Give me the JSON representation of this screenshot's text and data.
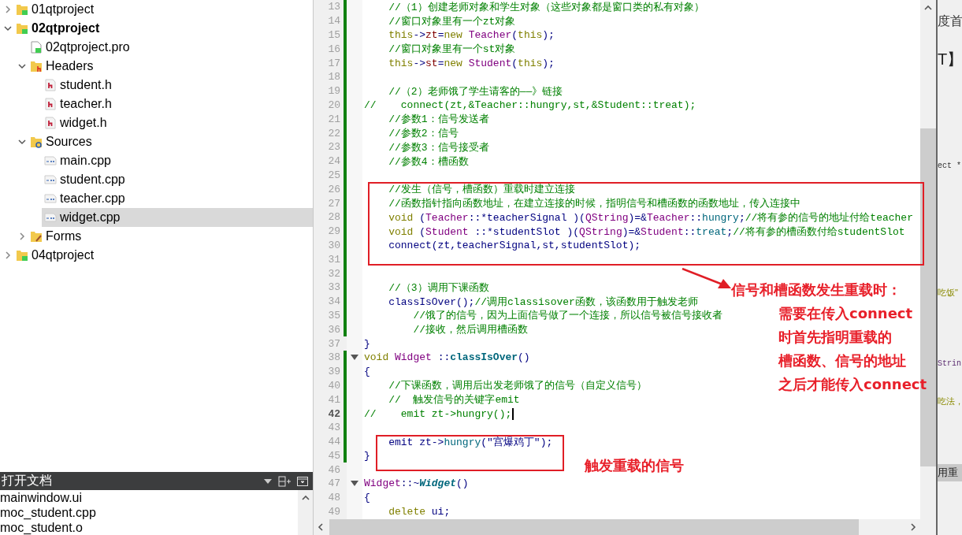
{
  "tree": {
    "items": [
      {
        "label": "01qtproject",
        "kind": "project",
        "expanded": false,
        "active": false,
        "selected": false
      },
      {
        "label": "02qtproject",
        "kind": "project",
        "expanded": true,
        "active": true,
        "selected": false,
        "children": [
          {
            "label": "02qtproject.pro",
            "kind": "pro",
            "selected": false
          },
          {
            "label": "Headers",
            "kind": "headers",
            "expanded": true,
            "selected": false,
            "children": [
              {
                "label": "student.h",
                "kind": "header",
                "selected": false
              },
              {
                "label": "teacher.h",
                "kind": "header",
                "selected": false
              },
              {
                "label": "widget.h",
                "kind": "header",
                "selected": false
              }
            ]
          },
          {
            "label": "Sources",
            "kind": "sources",
            "expanded": true,
            "selected": false,
            "children": [
              {
                "label": "main.cpp",
                "kind": "source",
                "selected": false
              },
              {
                "label": "student.cpp",
                "kind": "source",
                "selected": false
              },
              {
                "label": "teacher.cpp",
                "kind": "source",
                "selected": false
              },
              {
                "label": "widget.cpp",
                "kind": "source",
                "selected": true
              }
            ]
          },
          {
            "label": "Forms",
            "kind": "forms",
            "expanded": false,
            "selected": false
          }
        ]
      },
      {
        "label": "04qtproject",
        "kind": "project",
        "expanded": false,
        "active": false,
        "selected": false
      }
    ]
  },
  "open_documents": {
    "title": "打开文档",
    "files": [
      "mainwindow.ui",
      "moc_student.cpp",
      "moc_student.o"
    ]
  },
  "editor": {
    "lines": [
      {
        "number": "13",
        "modified": true,
        "foldable": false,
        "current": false,
        "segments": [
          {
            "kind": "comment",
            "text": "    //（1）创建老师对象和学生对象（这些对象都是窗口类的私有对象）"
          }
        ]
      },
      {
        "number": "14",
        "modified": true,
        "foldable": false,
        "current": false,
        "segments": [
          {
            "kind": "comment",
            "text": "    //窗口对象里有一个zt对象"
          }
        ]
      },
      {
        "number": "15",
        "modified": true,
        "foldable": false,
        "current": false,
        "segments": [
          {
            "kind": "keyword",
            "text": "    this"
          },
          {
            "kind": "plain",
            "text": "->"
          },
          {
            "kind": "member",
            "text": "zt"
          },
          {
            "kind": "plain",
            "text": "="
          },
          {
            "kind": "keyword",
            "text": "new"
          },
          {
            "kind": "type",
            "text": " Teacher"
          },
          {
            "kind": "plain",
            "text": "("
          },
          {
            "kind": "keyword",
            "text": "this"
          },
          {
            "kind": "plain",
            "text": ");"
          }
        ]
      },
      {
        "number": "16",
        "modified": true,
        "foldable": false,
        "current": false,
        "segments": [
          {
            "kind": "comment",
            "text": "    //窗口对象里有一个st对象"
          }
        ]
      },
      {
        "number": "17",
        "modified": true,
        "foldable": false,
        "current": false,
        "segments": [
          {
            "kind": "keyword",
            "text": "    this"
          },
          {
            "kind": "plain",
            "text": "->"
          },
          {
            "kind": "member",
            "text": "st"
          },
          {
            "kind": "plain",
            "text": "="
          },
          {
            "kind": "keyword",
            "text": "new"
          },
          {
            "kind": "type",
            "text": " Student"
          },
          {
            "kind": "plain",
            "text": "("
          },
          {
            "kind": "keyword",
            "text": "this"
          },
          {
            "kind": "plain",
            "text": ");"
          }
        ]
      },
      {
        "number": "18",
        "modified": true,
        "foldable": false,
        "current": false
      },
      {
        "number": "19",
        "modified": true,
        "foldable": false,
        "current": false,
        "segments": [
          {
            "kind": "comment",
            "text": "    //（2）老师饿了学生请客的——》链接"
          }
        ]
      },
      {
        "number": "20",
        "modified": true,
        "foldable": false,
        "current": false,
        "segments": [
          {
            "kind": "comment",
            "text": "//    connect(zt,&Teacher::hungry,st,&Student::treat);"
          }
        ]
      },
      {
        "number": "21",
        "modified": true,
        "foldable": false,
        "current": false,
        "segments": [
          {
            "kind": "comment",
            "text": "    //参数1：信号发送者"
          }
        ]
      },
      {
        "number": "22",
        "modified": true,
        "foldable": false,
        "current": false,
        "segments": [
          {
            "kind": "comment",
            "text": "    //参数2：信号"
          }
        ]
      },
      {
        "number": "23",
        "modified": true,
        "foldable": false,
        "current": false,
        "segments": [
          {
            "kind": "comment",
            "text": "    //参数3：信号接受者"
          }
        ]
      },
      {
        "number": "24",
        "modified": true,
        "foldable": false,
        "current": false,
        "segments": [
          {
            "kind": "comment",
            "text": "    //参数4：槽函数"
          }
        ]
      },
      {
        "number": "25",
        "modified": true,
        "foldable": false,
        "current": false
      },
      {
        "number": "26",
        "modified": true,
        "foldable": false,
        "current": false,
        "segments": [
          {
            "kind": "comment",
            "text": "    //发生（信号，槽函数）重载时建立连接"
          }
        ]
      },
      {
        "number": "27",
        "modified": true,
        "foldable": false,
        "current": false,
        "segments": [
          {
            "kind": "comment",
            "text": "    //函数指针指向函数地址，在建立连接的时候，指明信号和槽函数的函数地址，传入连接中"
          }
        ]
      },
      {
        "number": "28",
        "modified": true,
        "foldable": false,
        "current": false,
        "segments": [
          {
            "kind": "keyword",
            "text": "    void"
          },
          {
            "kind": "plain",
            "text": " ("
          },
          {
            "kind": "type",
            "text": "Teacher"
          },
          {
            "kind": "plain",
            "text": "::*teacherSignal )("
          },
          {
            "kind": "type",
            "text": "QString"
          },
          {
            "kind": "plain",
            "text": ")=&"
          },
          {
            "kind": "type",
            "text": "Teacher"
          },
          {
            "kind": "plain",
            "text": "::"
          },
          {
            "kind": "method",
            "text": "hungry"
          },
          {
            "kind": "plain",
            "text": ";"
          },
          {
            "kind": "comment",
            "text": "//将有参的信号的地址付给teacher"
          }
        ]
      },
      {
        "number": "29",
        "modified": true,
        "foldable": false,
        "current": false,
        "segments": [
          {
            "kind": "keyword",
            "text": "    void"
          },
          {
            "kind": "plain",
            "text": " ("
          },
          {
            "kind": "type",
            "text": "Student"
          },
          {
            "kind": "plain",
            "text": " ::*studentSlot )("
          },
          {
            "kind": "type",
            "text": "QString"
          },
          {
            "kind": "plain",
            "text": ")=&"
          },
          {
            "kind": "type",
            "text": "Student"
          },
          {
            "kind": "plain",
            "text": "::"
          },
          {
            "kind": "method",
            "text": "treat"
          },
          {
            "kind": "plain",
            "text": ";"
          },
          {
            "kind": "comment",
            "text": "//将有参的槽函数付给studentSlot"
          }
        ]
      },
      {
        "number": "30",
        "modified": true,
        "foldable": false,
        "current": false,
        "segments": [
          {
            "kind": "plain",
            "text": "    connect(zt,teacherSignal,st,studentSlot);"
          }
        ]
      },
      {
        "number": "31",
        "modified": true,
        "foldable": false,
        "current": false
      },
      {
        "number": "32",
        "modified": true,
        "foldable": false,
        "current": false
      },
      {
        "number": "33",
        "modified": true,
        "foldable": false,
        "current": false,
        "segments": [
          {
            "kind": "comment",
            "text": "    //（3）调用下课函数"
          }
        ]
      },
      {
        "number": "34",
        "modified": true,
        "foldable": false,
        "current": false,
        "segments": [
          {
            "kind": "plain",
            "text": "    classIsOver();"
          },
          {
            "kind": "comment",
            "text": "//调用classisover函数，该函数用于触发老师"
          }
        ]
      },
      {
        "number": "35",
        "modified": true,
        "foldable": false,
        "current": false,
        "segments": [
          {
            "kind": "comment",
            "text": "        //饿了的信号，因为上面信号做了一个连接，所以信号被信号接收者"
          }
        ]
      },
      {
        "number": "36",
        "modified": true,
        "foldable": false,
        "current": false,
        "segments": [
          {
            "kind": "comment",
            "text": "        //接收，然后调用槽函数"
          }
        ]
      },
      {
        "number": "37",
        "modified": false,
        "foldable": false,
        "current": false,
        "segments": [
          {
            "kind": "plain",
            "text": "}"
          }
        ]
      },
      {
        "number": "38",
        "modified": true,
        "foldable": true,
        "current": false,
        "segments": [
          {
            "kind": "keyword",
            "text": "void"
          },
          {
            "kind": "type",
            "text": " Widget"
          },
          {
            "kind": "plain",
            "text": " ::"
          },
          {
            "kind": "declaration",
            "text": "classIsOver"
          },
          {
            "kind": "plain",
            "text": "()"
          }
        ]
      },
      {
        "number": "39",
        "modified": true,
        "foldable": false,
        "current": false,
        "segments": [
          {
            "kind": "plain",
            "text": "{"
          }
        ]
      },
      {
        "number": "40",
        "modified": true,
        "foldable": false,
        "current": false,
        "segments": [
          {
            "kind": "comment",
            "text": "    //下课函数，调用后出发老师饿了的信号（自定义信号）"
          }
        ]
      },
      {
        "number": "41",
        "modified": true,
        "foldable": false,
        "current": false,
        "segments": [
          {
            "kind": "comment",
            "text": "    //  触发信号的关键字emit"
          }
        ]
      },
      {
        "number": "42",
        "modified": true,
        "foldable": false,
        "current": true,
        "segments": [
          {
            "kind": "comment",
            "text": "//    emit zt->hungry();"
          }
        ]
      },
      {
        "number": "43",
        "modified": true,
        "foldable": false,
        "current": false
      },
      {
        "number": "44",
        "modified": true,
        "foldable": false,
        "current": false,
        "segments": [
          {
            "kind": "plain",
            "text": "    emit zt->"
          },
          {
            "kind": "method",
            "text": "hungry"
          },
          {
            "kind": "plain",
            "text": "(\"宫爆鸡丁\");"
          }
        ]
      },
      {
        "number": "45",
        "modified": true,
        "foldable": false,
        "current": false,
        "segments": [
          {
            "kind": "plain",
            "text": "}"
          }
        ]
      },
      {
        "number": "46",
        "modified": false,
        "foldable": false,
        "current": false
      },
      {
        "number": "47",
        "modified": false,
        "foldable": true,
        "current": false,
        "segments": [
          {
            "kind": "type",
            "text": "Widget"
          },
          {
            "kind": "plain",
            "text": "::~"
          },
          {
            "kind": "destructor",
            "text": "Widget"
          },
          {
            "kind": "plain",
            "text": "()"
          }
        ]
      },
      {
        "number": "48",
        "modified": false,
        "foldable": false,
        "current": false,
        "segments": [
          {
            "kind": "plain",
            "text": "{"
          }
        ]
      },
      {
        "number": "49",
        "modified": false,
        "foldable": false,
        "current": false,
        "segments": [
          {
            "kind": "keyword",
            "text": "    delete"
          },
          {
            "kind": "plain",
            "text": " ui;"
          }
        ]
      }
    ]
  },
  "background_window": {
    "fragments": [
      {
        "kind": "heading",
        "text": "度首"
      },
      {
        "kind": "title",
        "text": "T】"
      },
      {
        "kind": "code",
        "text": "ect *"
      },
      {
        "kind": "string",
        "text": "吃饭\""
      },
      {
        "kind": "type",
        "text": "Strin"
      },
      {
        "kind": "string",
        "text": "吃法，"
      },
      {
        "kind": "band",
        "text": "用重"
      }
    ]
  },
  "annotations": {
    "callout": [
      "信号和槽函数发生重载时：",
      "需要在传入connect",
      "时首先指明重载的",
      "槽函数、信号的地址",
      "之后才能传入connect"
    ],
    "label": "触发重载的信号"
  }
}
